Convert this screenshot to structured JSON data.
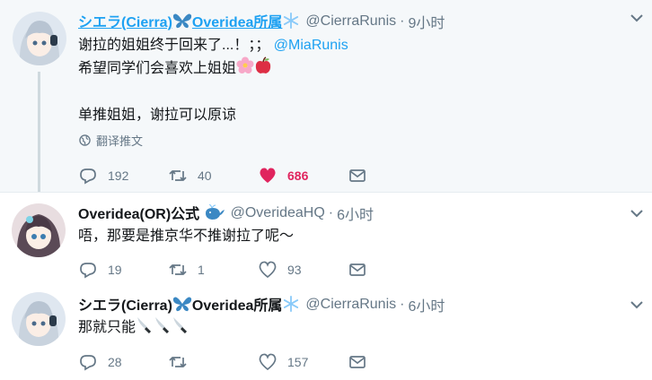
{
  "tweets": [
    {
      "name_prefix": "シエラ(Cierra)",
      "name_suffix": "Overidea所属",
      "handle": "@CierraRunis",
      "dot": "·",
      "time": "9小时",
      "line1_text": "谢拉的姐姐终于回来了...！；；",
      "line1_mention": "@MiaRunis",
      "line2_text": "希望同学们会喜欢上姐姐",
      "line3_text": "单推姐姐，谢拉可以原谅",
      "translate_label": "翻译推文",
      "reply_count": "192",
      "retweet_count": "40",
      "like_count": "686"
    },
    {
      "name": "Overidea(OR)公式",
      "handle": "@OverideaHQ",
      "dot": "·",
      "time": "6小时",
      "text": "唔，那要是推京华不推谢拉了呢～",
      "reply_count": "19",
      "retweet_count": "1",
      "like_count": "93"
    },
    {
      "name_prefix": "シエラ(Cierra)",
      "name_suffix": "Overidea所属",
      "handle": "@CierraRunis",
      "dot": "·",
      "time": "6小时",
      "text": "那就只能",
      "reply_count": "28",
      "retweet_count": "",
      "like_count": "157"
    }
  ],
  "icons": [
    "butterfly-icon",
    "snowflake-icon",
    "flower-icon",
    "apple-icon",
    "whale-icon",
    "knife-icon",
    "globe-icon",
    "reply-icon",
    "retweet-icon",
    "heart-icon",
    "message-icon",
    "chevron-down-icon"
  ],
  "colors": {
    "link": "#1da1f2",
    "muted": "#657786",
    "like": "#e0245e",
    "highlight_bg": "#f5f8fa"
  }
}
